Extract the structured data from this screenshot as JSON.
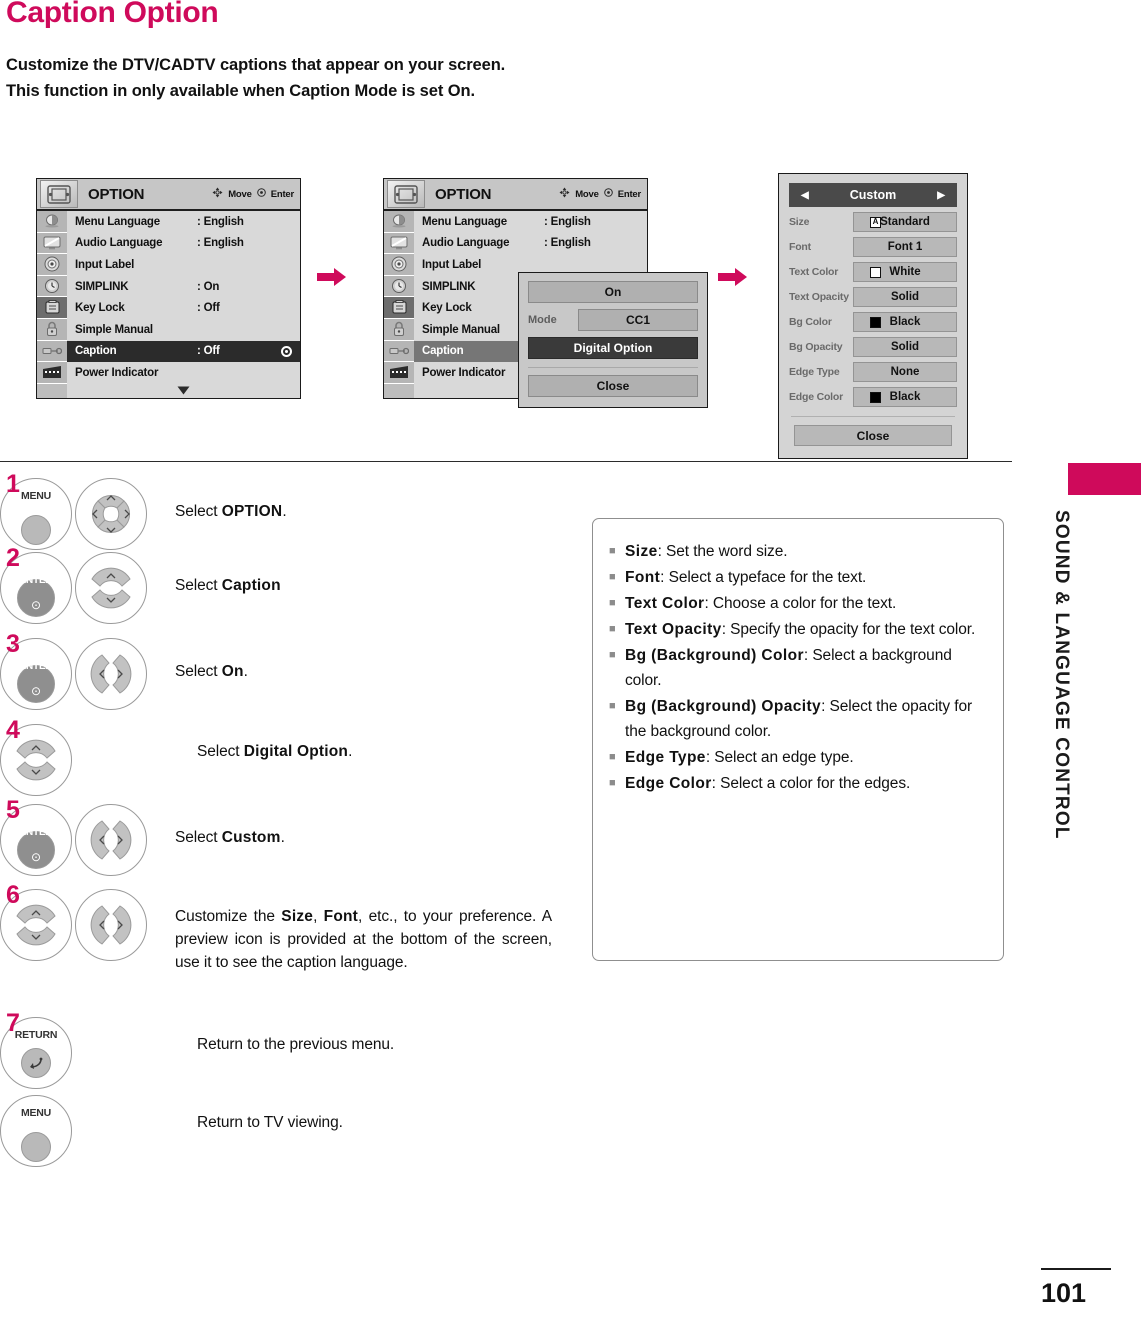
{
  "header": {
    "title": "Caption Option",
    "intro_line1": "Customize the DTV/CADTV captions that appear on your screen.",
    "intro_line2_a": "This function in only available when ",
    "intro_line2_b": "Caption",
    "intro_line2_c": " Mode is set ",
    "intro_line2_d": "On",
    "intro_line2_e": "."
  },
  "osd": {
    "title": "OPTION",
    "hint_move": "Move",
    "hint_enter": "Enter",
    "scroll_down_icon": "triangle-down-icon",
    "menu_icon": "option-menu-icon",
    "sidebar_icons": [
      "picture-icon",
      "screen-icon",
      "audio-icon",
      "time-icon",
      "option-icon",
      "lock-icon",
      "input-icon",
      "usb-icon"
    ],
    "rows": [
      {
        "label": "Menu Language",
        "value": ": English"
      },
      {
        "label": "Audio Language",
        "value": ": English"
      },
      {
        "label": "Input Label",
        "value": ""
      },
      {
        "label": "SIMPLINK",
        "value": ": On"
      },
      {
        "label": "Key Lock",
        "value": ": Off"
      },
      {
        "label": "Simple Manual",
        "value": ""
      },
      {
        "label": "Caption",
        "value": ": Off"
      },
      {
        "label": "Power Indicator",
        "value": ""
      }
    ],
    "rows2": [
      {
        "label": "Menu Language",
        "value": ": English"
      },
      {
        "label": "Audio Language",
        "value": ": English"
      },
      {
        "label": "Input Label",
        "value": ""
      },
      {
        "label": "SIMPLINK",
        "value": ""
      },
      {
        "label": "Key Lock",
        "value": ""
      },
      {
        "label": "Simple Manual",
        "value": ""
      },
      {
        "label": "Caption",
        "value": ""
      },
      {
        "label": "Power Indicator",
        "value": ""
      }
    ]
  },
  "popup": {
    "on_label": "On",
    "mode_label": "Mode",
    "mode_value": "CC1",
    "digital_option": "Digital Option",
    "close": "Close"
  },
  "custom": {
    "header_title": "Custom",
    "arrow_left": "◀",
    "arrow_right": "▶",
    "rows": [
      {
        "label": "Size",
        "value": "Standard",
        "swatch": "glyph-A"
      },
      {
        "label": "Font",
        "value": "Font 1",
        "swatch": "none"
      },
      {
        "label": "Text Color",
        "value": "White",
        "swatch": "white"
      },
      {
        "label": "Text Opacity",
        "value": "Solid",
        "swatch": "none"
      },
      {
        "label": "Bg Color",
        "value": "Black",
        "swatch": "black"
      },
      {
        "label": "Bg Opacity",
        "value": "Solid",
        "swatch": "none"
      },
      {
        "label": "Edge Type",
        "value": "None",
        "swatch": "none"
      },
      {
        "label": "Edge Color",
        "value": "Black",
        "swatch": "black"
      }
    ],
    "close": "Close",
    "size_glyph": "A"
  },
  "steps": [
    {
      "num": "1",
      "key1": "MENU",
      "key2": "updownleftright-pad-icon",
      "text_pre": "Select ",
      "text_bold": "OPTION",
      "text_post": "."
    },
    {
      "num": "2",
      "key1": "ENTER",
      "key2": "updown-pad-icon",
      "text_pre": "Select ",
      "text_bold": "Caption",
      "text_post": ""
    },
    {
      "num": "3",
      "key1": "ENTER",
      "key2": "leftright-pad-icon",
      "text_pre": "Select ",
      "text_bold": "On",
      "text_post": "."
    },
    {
      "num": "4",
      "key1": "",
      "key2": "updown-pad-icon",
      "text_pre": "Select ",
      "text_bold": "Digital Option",
      "text_post": "."
    },
    {
      "num": "5",
      "key1": "ENTER",
      "key2": "leftright-pad-icon",
      "text_pre": "Select ",
      "text_bold": "Custom",
      "text_post": "."
    },
    {
      "num": "6",
      "key1": "updown-pad-icon",
      "key2": "leftright-pad-icon",
      "text_pre": "Customize the ",
      "text_bold": "Size",
      "text_bold2": "Font",
      "text_post": ", etc., to your preference. A preview icon is provided at the bottom of the screen, use it to see the caption language."
    },
    {
      "num": "7",
      "key1": "RETURN",
      "key2": "",
      "text_pre": "Return to the previous menu.",
      "text_bold": "",
      "text_post": ""
    },
    {
      "num": "",
      "key1": "MENU",
      "key2": "",
      "text_pre": "Return to TV viewing.",
      "text_bold": "",
      "text_post": ""
    }
  ],
  "notes": [
    {
      "term": "Size",
      "desc": ": Set the word size."
    },
    {
      "term": "Font",
      "desc": ": Select a typeface for the text."
    },
    {
      "term": "Text Color",
      "desc": ": Choose a color for the text."
    },
    {
      "term": "Text Opacity",
      "desc": ": Specify the opacity for the text color."
    },
    {
      "term": "Bg (Background) Color",
      "desc": ": Select a background color."
    },
    {
      "term": "Bg (Background) Opacity",
      "desc": ": Select the opacity for the background color."
    },
    {
      "term": "Edge Type",
      "desc": ": Select an edge type."
    },
    {
      "term": "Edge Color",
      "desc": ": Select a color for the edges."
    }
  ],
  "sidebar": {
    "section_label": "SOUND & LANGUAGE CONTROL",
    "accent_color": "#cf0a5b"
  },
  "footer": {
    "page_number": "101"
  }
}
